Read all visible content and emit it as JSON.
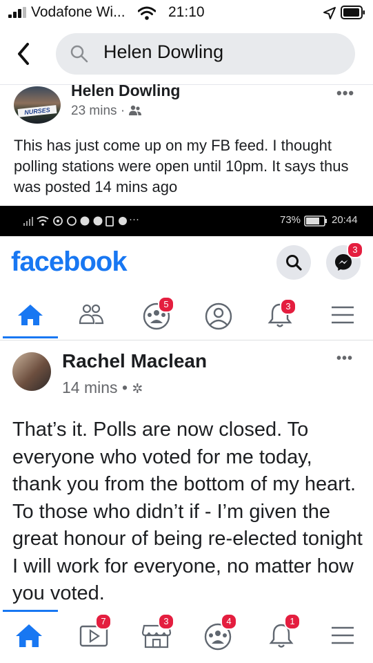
{
  "status_bar": {
    "carrier": "Vodafone Wi...",
    "time": "21:10"
  },
  "search": {
    "query": "Helen Dowling"
  },
  "outer_post": {
    "author": "Helen Dowling",
    "avatar_text": "NURSES",
    "time": "23 mins",
    "separator": "·",
    "text": "This has just come up on my FB feed. I thought polling stations were open until 10pm. It says thus was posted 14 mins ago"
  },
  "embedded": {
    "android_status": {
      "battery": "73%",
      "time": "20:44",
      "more": "···"
    },
    "brand": "facebook",
    "colors": {
      "brand": "#1877f2",
      "badge": "#e41e3f"
    },
    "messenger_badge": "3",
    "nav_badges": {
      "groups": "5",
      "notifications": "3"
    },
    "post": {
      "author": "Rachel Maclean",
      "time": "14 mins",
      "separator": "•",
      "text": "That’s it. Polls are now closed. To everyone who voted for me today, thank you from the bottom of my heart. To those who didn’t if - I’m given the great honour of being re-elected tonight I will work for everyone, no matter how you voted."
    }
  },
  "bottom_tabs": {
    "watch_badge": "7",
    "marketplace_badge": "3",
    "groups_badge": "4",
    "notifications_badge": "1"
  },
  "icons": [
    "back-chevron-icon",
    "search-icon",
    "home-icon",
    "watch-icon",
    "marketplace-icon",
    "groups-icon",
    "bell-icon",
    "menu-icon",
    "messenger-icon",
    "friends-icon",
    "profile-icon",
    "gear-icon",
    "more-dots-icon"
  ]
}
